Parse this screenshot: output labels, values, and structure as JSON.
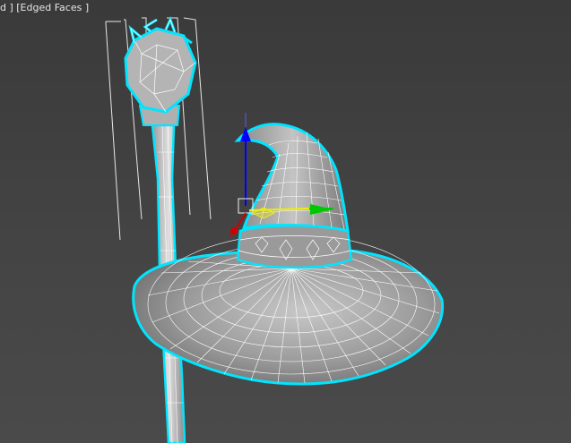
{
  "viewport": {
    "label": "d ] [Edged Faces ]",
    "shading_mode": "Edged Faces",
    "colors": {
      "background": "#424242",
      "selection_outline": "#00e5ff",
      "wireframe": "#ffffff",
      "mesh_fill": "#9a9a9a",
      "gizmo_x": "#00c800",
      "gizmo_y": "#f0f000",
      "gizmo_z": "#0000ff",
      "gizmo_pivot": "#d00000"
    }
  },
  "objects": [
    {
      "name": "staff",
      "icon": "staff-mesh",
      "selected": true
    },
    {
      "name": "witch-hat",
      "icon": "hat-mesh",
      "selected": true
    },
    {
      "name": "transform-gizmo",
      "icon": "move-gizmo",
      "axes": [
        "x",
        "y",
        "z"
      ],
      "pivot_label": "x"
    }
  ]
}
